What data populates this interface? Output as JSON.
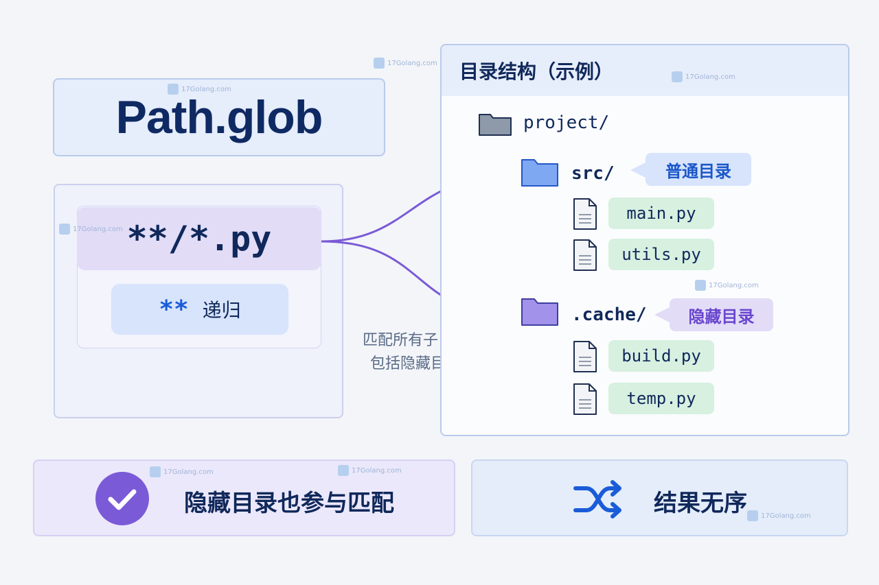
{
  "title": "Path.glob",
  "pattern": {
    "glob": "**/*.py",
    "recursive_token": "**",
    "recursive_label": "递归"
  },
  "match_note": {
    "line1": "匹配所有子目录",
    "line2": "包括隐藏目录"
  },
  "tree": {
    "header": "目录结构（示例）",
    "root": "project/",
    "src_dir": "src/",
    "src_files": [
      "main.py",
      "utils.py"
    ],
    "src_callout": "普通目录",
    "cache_dir": ".cache/",
    "cache_files": [
      "build.py",
      "temp.py"
    ],
    "cache_callout": "隐藏目录"
  },
  "notes": {
    "hidden_match": "隐藏目录也参与匹配",
    "unordered": "结果无序"
  },
  "watermark": "17Golang.com",
  "colors": {
    "accent_purple": "#7a5ad6",
    "accent_blue": "#1a5cd8",
    "navy": "#10285a"
  }
}
